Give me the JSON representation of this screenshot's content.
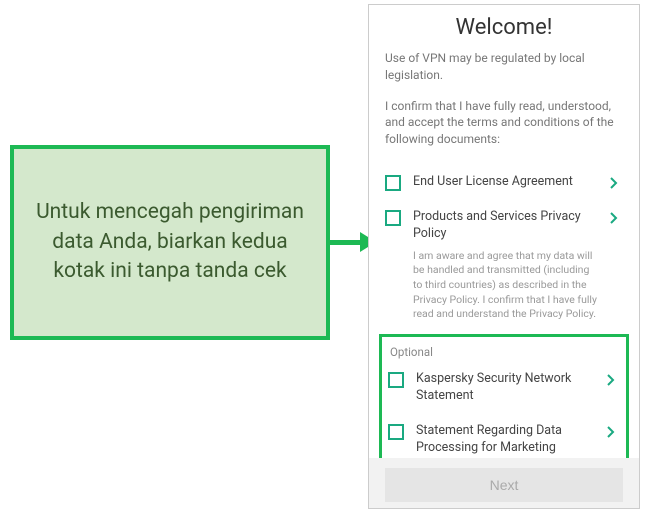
{
  "callout": {
    "text": "Untuk mencegah pengiriman data Anda, biarkan kedua kotak ini tanpa tanda cek"
  },
  "phone": {
    "title": "Welcome!",
    "intro1": "Use of VPN may be regulated by local legislation.",
    "intro2": "I confirm that I have fully read, understood, and accept the terms and conditions of the following documents:",
    "items": [
      {
        "label": "End User License Agreement",
        "desc": ""
      },
      {
        "label": "Products and Services Privacy Policy",
        "desc": "I am aware and agree that my data will be handled and transmitted (including to third countries) as described in the Privacy Policy. I confirm that I have fully read and understand the Privacy Policy."
      }
    ],
    "optional_label": "Optional",
    "optional_items": [
      {
        "label": "Kaspersky Security Network Statement"
      },
      {
        "label": "Statement Regarding Data Processing for Marketing Purposes"
      }
    ],
    "next_label": "Next"
  }
}
